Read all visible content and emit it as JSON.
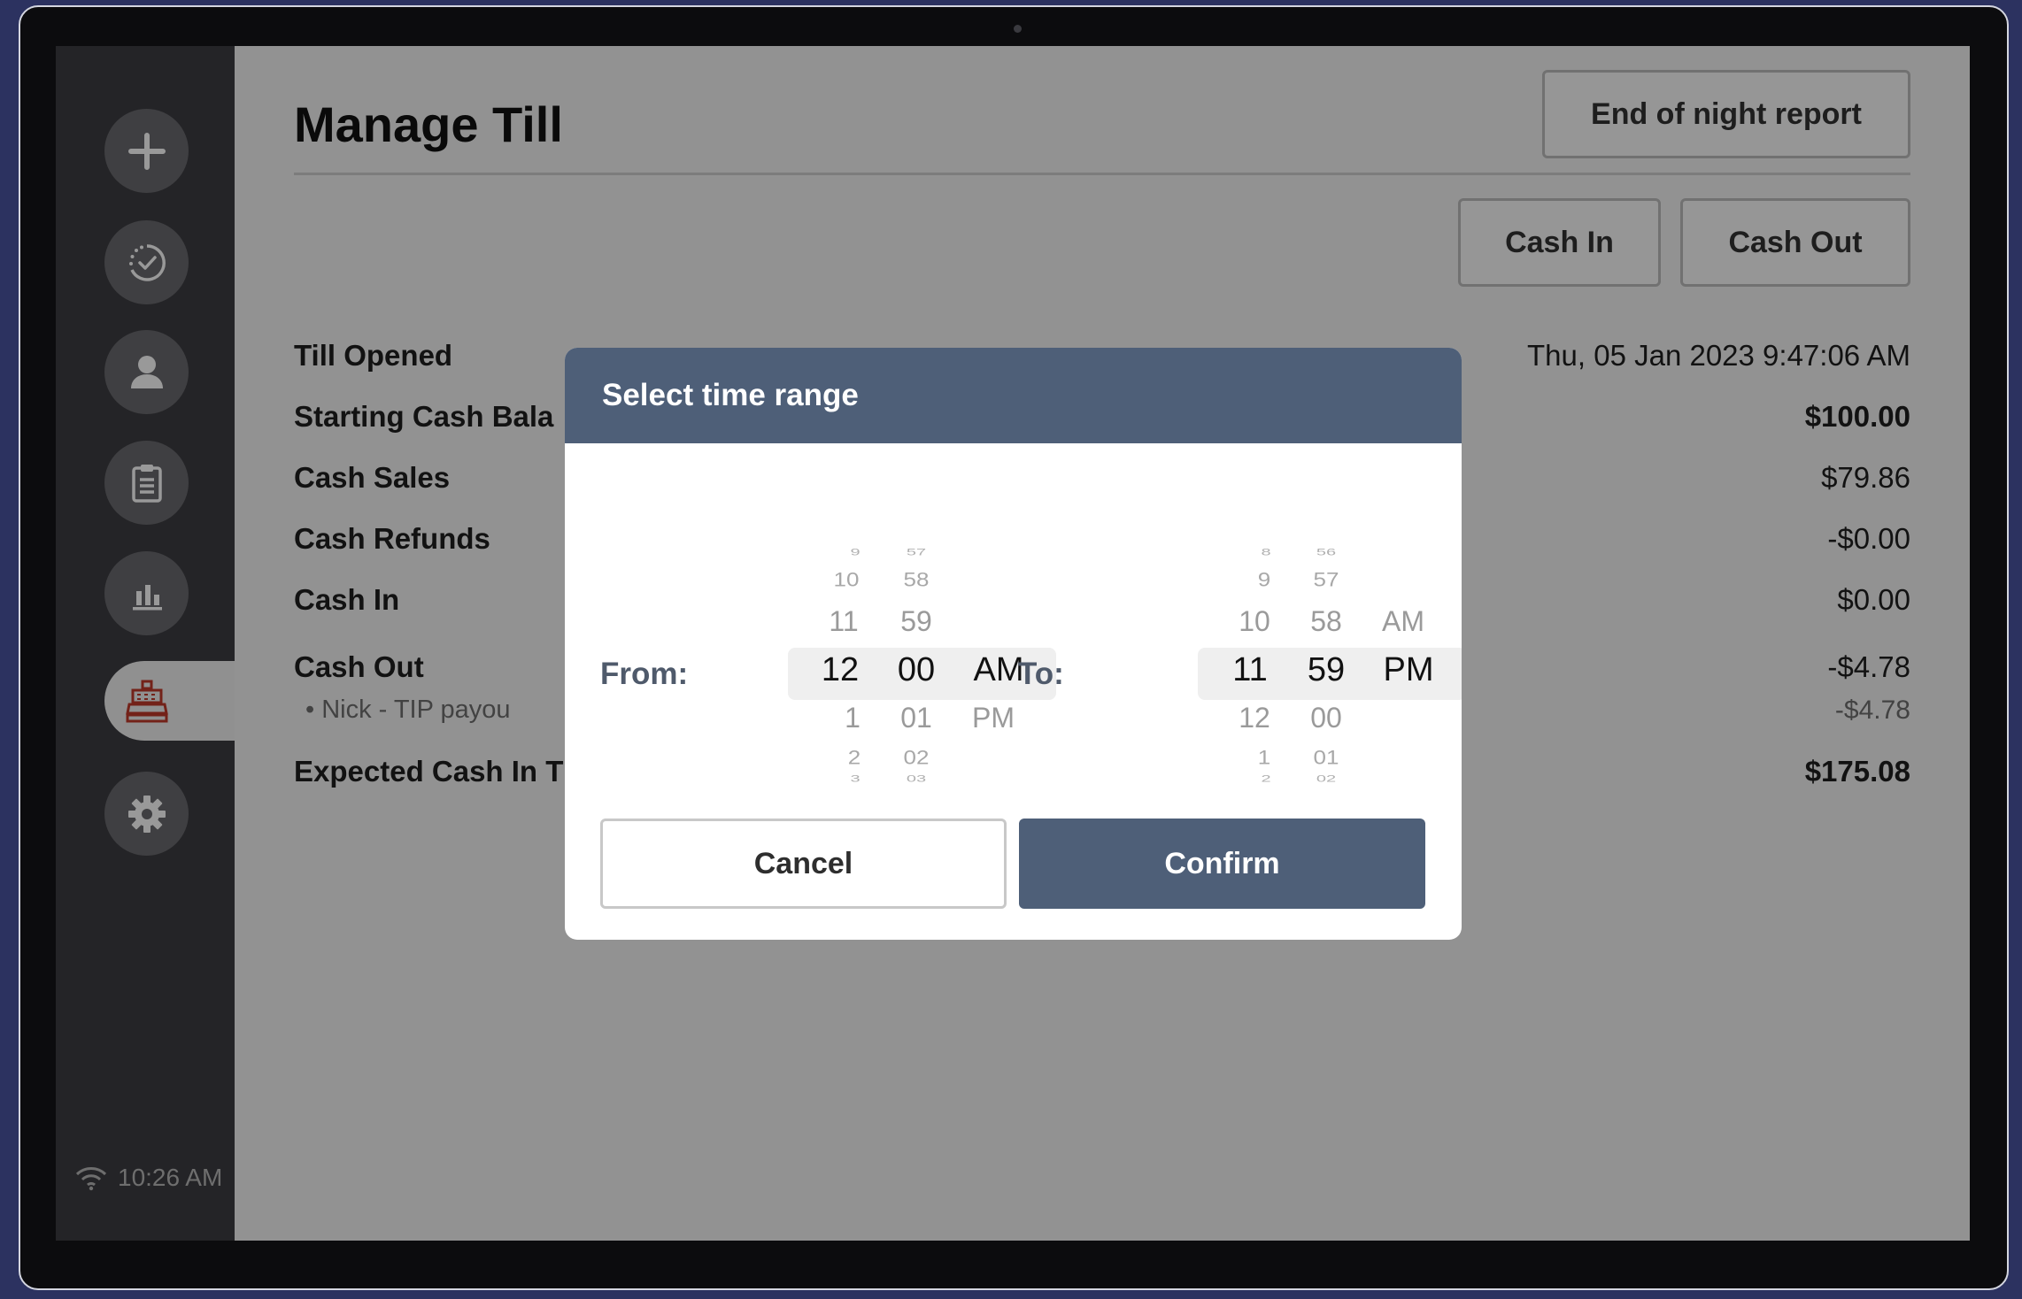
{
  "header": {
    "title": "Manage Till",
    "end_of_night_label": "End of night report",
    "cash_in_label": "Cash In",
    "cash_out_label": "Cash Out"
  },
  "nav": {
    "items": [
      "new-order",
      "orders-completed",
      "customers",
      "clipboard",
      "reports",
      "till",
      "settings"
    ],
    "active": "till"
  },
  "status": {
    "time": "10:26 AM"
  },
  "till": {
    "till_opened_label": "Till Opened",
    "till_opened_value": "Thu, 05 Jan 2023 9:47:06 AM",
    "starting_label": "Starting Cash Bala",
    "starting_value": "$100.00",
    "cash_sales_label": "Cash Sales",
    "cash_sales_value": "$79.86",
    "cash_refunds_label": "Cash Refunds",
    "cash_refunds_value": "-$0.00",
    "cash_in_label": "Cash In",
    "cash_in_value": "$0.00",
    "cash_out_label": "Cash Out",
    "cash_out_value": "-$4.78",
    "payout_label": "• Nick - TIP payou",
    "payout_value": "-$4.78",
    "expected_label": "Expected Cash In T",
    "expected_value": "$175.08"
  },
  "modal": {
    "title": "Select time range",
    "from_label": "From:",
    "to_label": "To:",
    "cancel_label": "Cancel",
    "confirm_label": "Confirm",
    "from": {
      "hour_above": [
        "9",
        "10",
        "11"
      ],
      "hour": "12",
      "hour_below": [
        "1",
        "2",
        "3"
      ],
      "minute_above": [
        "57",
        "58",
        "59"
      ],
      "minute": "00",
      "minute_below": [
        "01",
        "02",
        "03"
      ],
      "period_above": "",
      "period": "AM",
      "period_below": "PM"
    },
    "to": {
      "hour_above": [
        "8",
        "9",
        "10"
      ],
      "hour": "11",
      "hour_below": [
        "12",
        "1",
        "2"
      ],
      "minute_above": [
        "56",
        "57",
        "58"
      ],
      "minute": "59",
      "minute_below": [
        "00",
        "01",
        "02"
      ],
      "period_above": "AM",
      "period": "PM",
      "period_below": ""
    }
  },
  "colors": {
    "modal_header": "#4e5f78",
    "confirm_button": "#4e5f78",
    "active_nav_icon": "#c0392b",
    "sidebar": "#3d3d42"
  }
}
